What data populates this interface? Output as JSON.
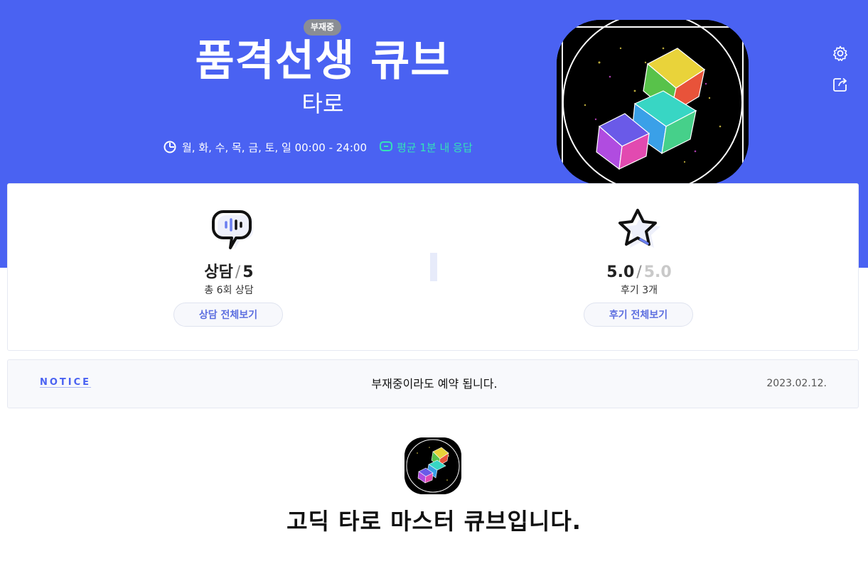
{
  "header": {
    "status_badge": "부재중",
    "title": "품격선생 큐브",
    "category": "타로",
    "hours": "월, 화, 수, 목, 금, 토, 일 00:00 - 24:00",
    "response": "평균 1분 내 응답",
    "hours_icon": "clock-icon",
    "response_icon": "chat-icon"
  },
  "side_actions": {
    "settings_icon": "gear-icon",
    "share_icon": "share-icon"
  },
  "stats": {
    "consult": {
      "icon": "speech-bubble-icon",
      "label": "상담",
      "separator": "/",
      "value": "5",
      "sub": "총 6회 상담",
      "button": "상담 전체보기"
    },
    "review": {
      "icon": "star-icon",
      "score": "5.0",
      "separator": "/",
      "max": "5.0",
      "sub": "후기 3개",
      "button": "후기 전체보기"
    }
  },
  "notice": {
    "tag": "NOTICE",
    "text": "부재중이라도 예약 됩니다.",
    "date": "2023.02.12."
  },
  "intro": {
    "text": "고딕 타로 마스터 큐브입니다."
  },
  "colors": {
    "hero": "#4a62f2",
    "accent": "#5d6fe0",
    "response": "#34e3b8",
    "badge": "#8a8d94"
  }
}
